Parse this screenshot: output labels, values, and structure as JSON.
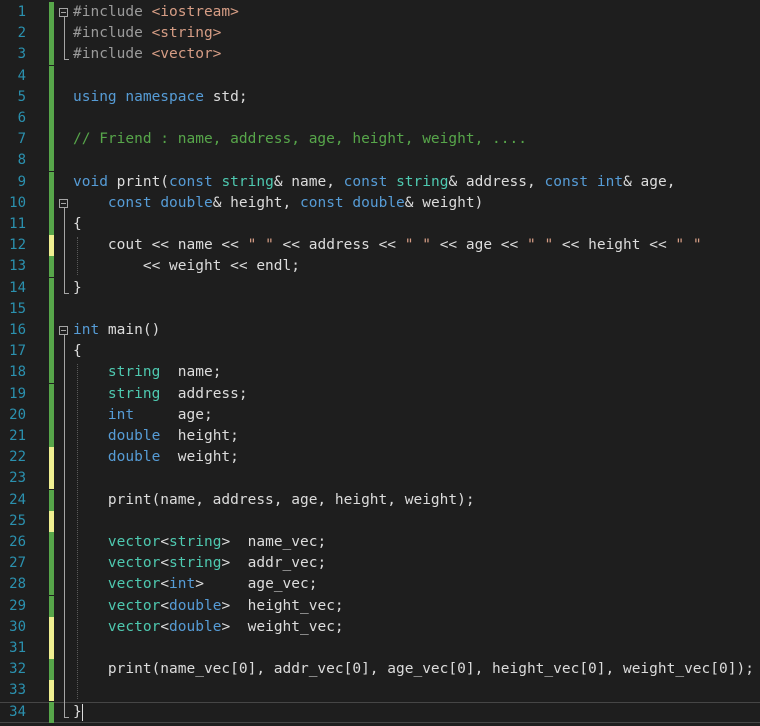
{
  "editor": {
    "lines": [
      {
        "n": "1",
        "status": "saved",
        "tokens": [
          [
            "pp",
            "#include "
          ],
          [
            "str",
            "<iostream>"
          ]
        ]
      },
      {
        "n": "2",
        "status": "saved",
        "tokens": [
          [
            "pp",
            "#include "
          ],
          [
            "str",
            "<string>"
          ]
        ]
      },
      {
        "n": "3",
        "status": "saved",
        "tokens": [
          [
            "pp",
            "#include "
          ],
          [
            "str",
            "<vector>"
          ]
        ]
      },
      {
        "n": "4",
        "status": "saved",
        "tokens": []
      },
      {
        "n": "5",
        "status": "saved",
        "tokens": [
          [
            "kw",
            "using "
          ],
          [
            "kw",
            "namespace "
          ],
          [
            "plain",
            "std;"
          ]
        ]
      },
      {
        "n": "6",
        "status": "saved",
        "tokens": []
      },
      {
        "n": "7",
        "status": "saved",
        "tokens": [
          [
            "cm",
            "// Friend : name, address, age, height, weight, ...."
          ]
        ]
      },
      {
        "n": "8",
        "status": "saved",
        "tokens": []
      },
      {
        "n": "9",
        "status": "saved",
        "tokens": [
          [
            "kw",
            "void "
          ],
          [
            "plain",
            "print("
          ],
          [
            "kw",
            "const "
          ],
          [
            "ty",
            "string"
          ],
          [
            "plain",
            "& name, "
          ],
          [
            "kw",
            "const "
          ],
          [
            "ty",
            "string"
          ],
          [
            "plain",
            "& address, "
          ],
          [
            "kw",
            "const "
          ],
          [
            "kw",
            "int"
          ],
          [
            "plain",
            "& age,"
          ]
        ]
      },
      {
        "n": "10",
        "status": "saved",
        "tokens": [
          [
            "plain",
            "    "
          ],
          [
            "kw",
            "const "
          ],
          [
            "kw",
            "double"
          ],
          [
            "plain",
            "& height, "
          ],
          [
            "kw",
            "const "
          ],
          [
            "kw",
            "double"
          ],
          [
            "plain",
            "& weight)"
          ]
        ]
      },
      {
        "n": "11",
        "status": "saved",
        "tokens": [
          [
            "plain",
            "{"
          ]
        ]
      },
      {
        "n": "12",
        "status": "unsaved",
        "tokens": [
          [
            "plain",
            "    cout << name << "
          ],
          [
            "str",
            "\" \""
          ],
          [
            "plain",
            " << address << "
          ],
          [
            "str",
            "\" \""
          ],
          [
            "plain",
            " << age << "
          ],
          [
            "str",
            "\" \""
          ],
          [
            "plain",
            " << height << "
          ],
          [
            "str",
            "\" \""
          ]
        ]
      },
      {
        "n": "13",
        "status": "saved",
        "tokens": [
          [
            "plain",
            "        << weight << endl;"
          ]
        ]
      },
      {
        "n": "14",
        "status": "saved",
        "tokens": [
          [
            "plain",
            "}"
          ]
        ]
      },
      {
        "n": "15",
        "status": "saved",
        "tokens": []
      },
      {
        "n": "16",
        "status": "saved",
        "tokens": [
          [
            "kw",
            "int "
          ],
          [
            "plain",
            "main()"
          ]
        ]
      },
      {
        "n": "17",
        "status": "saved",
        "tokens": [
          [
            "plain",
            "{"
          ]
        ]
      },
      {
        "n": "18",
        "status": "saved",
        "tokens": [
          [
            "plain",
            "    "
          ],
          [
            "ty",
            "string"
          ],
          [
            "plain",
            "  name;"
          ]
        ]
      },
      {
        "n": "19",
        "status": "saved",
        "tokens": [
          [
            "plain",
            "    "
          ],
          [
            "ty",
            "string"
          ],
          [
            "plain",
            "  address;"
          ]
        ]
      },
      {
        "n": "20",
        "status": "saved",
        "tokens": [
          [
            "plain",
            "    "
          ],
          [
            "kw",
            "int"
          ],
          [
            "plain",
            "     age;"
          ]
        ]
      },
      {
        "n": "21",
        "status": "saved",
        "tokens": [
          [
            "plain",
            "    "
          ],
          [
            "kw",
            "double"
          ],
          [
            "plain",
            "  height;"
          ]
        ]
      },
      {
        "n": "22",
        "status": "unsaved",
        "tokens": [
          [
            "plain",
            "    "
          ],
          [
            "kw",
            "double"
          ],
          [
            "plain",
            "  weight;"
          ]
        ]
      },
      {
        "n": "23",
        "status": "unsaved",
        "tokens": []
      },
      {
        "n": "24",
        "status": "saved",
        "tokens": [
          [
            "plain",
            "    print(name, address, age, height, weight);"
          ]
        ]
      },
      {
        "n": "25",
        "status": "unsaved",
        "tokens": []
      },
      {
        "n": "26",
        "status": "saved",
        "tokens": [
          [
            "plain",
            "    "
          ],
          [
            "ty",
            "vector"
          ],
          [
            "plain",
            "<"
          ],
          [
            "ty",
            "string"
          ],
          [
            "plain",
            ">  name_vec;"
          ]
        ]
      },
      {
        "n": "27",
        "status": "saved",
        "tokens": [
          [
            "plain",
            "    "
          ],
          [
            "ty",
            "vector"
          ],
          [
            "plain",
            "<"
          ],
          [
            "ty",
            "string"
          ],
          [
            "plain",
            ">  addr_vec;"
          ]
        ]
      },
      {
        "n": "28",
        "status": "saved",
        "tokens": [
          [
            "plain",
            "    "
          ],
          [
            "ty",
            "vector"
          ],
          [
            "plain",
            "<"
          ],
          [
            "kw",
            "int"
          ],
          [
            "plain",
            ">     age_vec;"
          ]
        ]
      },
      {
        "n": "29",
        "status": "saved",
        "tokens": [
          [
            "plain",
            "    "
          ],
          [
            "ty",
            "vector"
          ],
          [
            "plain",
            "<"
          ],
          [
            "kw",
            "double"
          ],
          [
            "plain",
            ">  height_vec;"
          ]
        ]
      },
      {
        "n": "30",
        "status": "unsaved",
        "tokens": [
          [
            "plain",
            "    "
          ],
          [
            "ty",
            "vector"
          ],
          [
            "plain",
            "<"
          ],
          [
            "kw",
            "double"
          ],
          [
            "plain",
            ">  weight_vec;"
          ]
        ]
      },
      {
        "n": "31",
        "status": "unsaved",
        "tokens": []
      },
      {
        "n": "32",
        "status": "saved",
        "tokens": [
          [
            "plain",
            "    print(name_vec[0], addr_vec[0], age_vec[0], height_vec[0], weight_vec[0]);"
          ]
        ]
      },
      {
        "n": "33",
        "status": "unsaved",
        "tokens": []
      },
      {
        "n": "34",
        "status": "saved",
        "tokens": [
          [
            "plain",
            "}"
          ]
        ],
        "current": true
      }
    ]
  },
  "colors": {
    "background": "#1e1e1e",
    "line_number": "#2b91af",
    "keyword": "#569cd6",
    "type": "#4ec9b0",
    "preprocessor": "#9b9b9b",
    "string": "#d69d85",
    "comment": "#57a64a",
    "text": "#dcdcdc",
    "change_saved": "#57a64a",
    "change_unsaved": "#efef91"
  },
  "icons": {
    "fold_toggle": "collapse-box-icon"
  }
}
